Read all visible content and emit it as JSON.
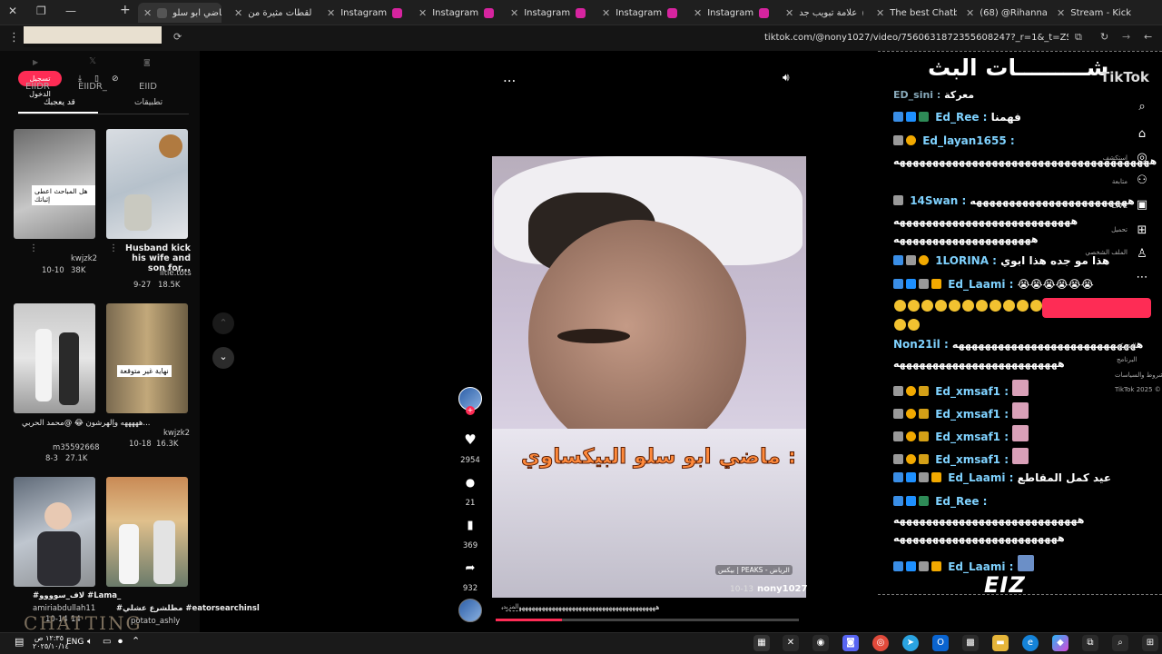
{
  "browser": {
    "tabs": [
      {
        "label": "ماضي ابو سلو",
        "icon": "tiktok-icon",
        "active": true
      },
      {
        "label": "لقطات مثيرة من",
        "icon": "tiktok-icon"
      },
      {
        "label": "Instagram",
        "icon": "instagram-icon"
      },
      {
        "label": "Instagram",
        "icon": "instagram-icon"
      },
      {
        "label": "Instagram",
        "icon": "instagram-icon"
      },
      {
        "label": "Instagram",
        "icon": "instagram-icon"
      },
      {
        "label": "Instagram",
        "icon": "instagram-icon"
      },
      {
        "label": "علامة تبويب جد",
        "icon": "chrome-icon"
      },
      {
        "label": "The best Chatb",
        "icon": "chatgpt-icon"
      },
      {
        "label": "(68) @Rihanna",
        "icon": "youtube-icon"
      },
      {
        "label": "Stream - Kick L",
        "icon": "kick-icon"
      }
    ],
    "url": "tiktok.com/@nony1027/video/7560631872355608247?_r=1&_t=ZS-90sDEllrHN2"
  },
  "left_panel": {
    "login_button": "تسجيل الدخول",
    "ext_labels": [
      "EIIDR",
      "EIIDR_",
      "EIID"
    ],
    "tabs": [
      "تطبيقات",
      "قد يعجبك"
    ],
    "videos": [
      {
        "caption": "",
        "overlay": "هل المباحث اعطى إثباتك",
        "author": "kwjzk2",
        "date": "10-10",
        "likes": "38K"
      },
      {
        "caption": "Husband kick his wife and son for...",
        "author": "litle.tots",
        "date": "9-27",
        "likes": "18.5K"
      },
      {
        "caption": "هههههه والهرشون 😂 @محمد الحربي...",
        "author": "m35592668",
        "date": "8-3",
        "likes": "27.1K"
      },
      {
        "caption": "",
        "overlay": "نهاية غير متوقعة",
        "author": "kwjzk2",
        "date": "10-18",
        "likes": "16.3K"
      },
      {
        "caption": "#لاف_سوووو #Lama_",
        "author": "amiriabdullah11",
        "date": "10-14",
        "likes": "14"
      },
      {
        "caption": "#مطلشرع عشلي #eatorsearchinsl",
        "author": "potato_ashly",
        "date": "",
        "likes": ""
      }
    ],
    "watermark": "CHATTING"
  },
  "player": {
    "more": "...",
    "video_text": "ماضي ابو سلو البيكساوي :",
    "location_tag": "بيكس | PEAKS - الرياض",
    "date": "10-13",
    "author": "nony1027",
    "description": "ههههههههههههههههههههههههههههههههههههههههههههههه",
    "more_label": "المزيد",
    "progress": 0.22,
    "actions": {
      "likes": "2954",
      "comments": "21",
      "saves": "369",
      "shares": "932"
    }
  },
  "chat": {
    "title": "شـــــــــات البث",
    "brand": "TikTok",
    "logo_text": "EIZ",
    "rows": [
      {
        "user": "ED_sini",
        "msg": "معركة"
      },
      {
        "user": "Ed_Ree",
        "msg": "فهمنا"
      },
      {
        "user": "Ed_layan1655",
        "msg": ""
      },
      {
        "user": "",
        "msg": "هههههههههههههههههههههههههههههههههههههههه"
      },
      {
        "user": "14Swan",
        "msg": "ههههههههههههههههههههههههه"
      },
      {
        "user": "",
        "msg": "هههههههههههههههههههههههههههه"
      },
      {
        "user": "",
        "msg": "هههههههههههههههههههههه"
      },
      {
        "user": "1LORINA",
        "msg": "هذا مو جده هذا ابوي"
      },
      {
        "user": "Ed_Laami",
        "msg": "😭😭😭😭😭😭"
      },
      {
        "user": "Non21il",
        "msg": "ههههههههههههههههههههههههههههه"
      },
      {
        "user": "",
        "msg": "هههههههههههههههههههههههههه"
      },
      {
        "user": "Ed_xmsaf1",
        "msg": ""
      },
      {
        "user": "Ed_xmsaf1",
        "msg": ""
      },
      {
        "user": "Ed_xmsaf1",
        "msg": ""
      },
      {
        "user": "Ed_xmsaf1",
        "msg": ""
      },
      {
        "user": "Ed_Laami",
        "msg": "عيد كمل المقاطع"
      },
      {
        "user": "Ed_Ree",
        "msg": ""
      },
      {
        "user": "",
        "msg": "ههههههههههههههههههههههههههههه"
      },
      {
        "user": "",
        "msg": "هههههههههههههههههههههههههه"
      },
      {
        "user": "Ed_Laami",
        "msg": ""
      }
    ]
  },
  "right_nav": {
    "items": [
      "استكشف",
      "متابعة",
      "LIVE",
      "تحميل",
      "الملف الشخصي"
    ],
    "footer": [
      "الشركة",
      "البرنامج",
      "الشروط والسياسات",
      "TikTok 2025 ©"
    ]
  },
  "taskbar": {
    "lang": "ENG",
    "time": "١٢:٣٥ ص",
    "date": "٢٠٢٥/١٠/١٤"
  }
}
